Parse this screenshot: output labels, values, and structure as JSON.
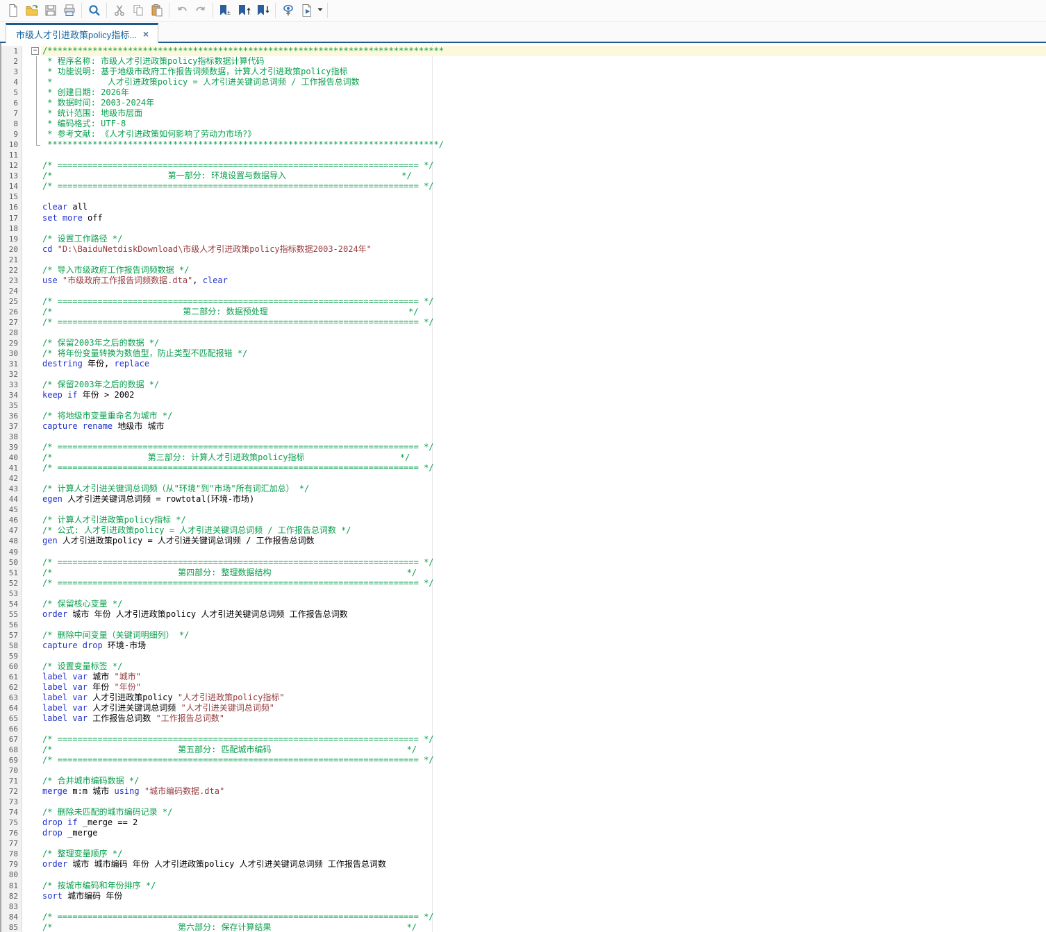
{
  "colors": {
    "accent": "#1C5A8E",
    "tab_title": "#1464A0",
    "current_line_bg": "#FCF8DC",
    "comment": "#089E4C",
    "keyword": "#2233CC",
    "string": "#973B3E",
    "plain": "#000000",
    "line_number": "#5C5C5C"
  },
  "toolbar": {
    "buttons": [
      "new-file",
      "open-file",
      "save-file",
      "print",
      "find",
      "cut",
      "copy",
      "paste",
      "undo",
      "redo",
      "bookmark-toggle",
      "bookmark-previous",
      "bookmark-next",
      "preview",
      "execute-do",
      "execute-menu"
    ]
  },
  "tab": {
    "title": "市级人才引进政策policy指标...",
    "close_glyph": "×"
  },
  "editor": {
    "current_line": 1,
    "total_lines": 85,
    "lines": [
      [
        {
          "t": "/*******************************************************************************",
          "c": "c"
        }
      ],
      [
        {
          "t": " * 程序名称: 市级人才引进政策policy指标数据计算代码",
          "c": "c"
        }
      ],
      [
        {
          "t": " * 功能说明: 基于地级市政府工作报告词频数据，计算人才引进政策policy指标",
          "c": "c"
        }
      ],
      [
        {
          "t": " *           人才引进政策policy = 人才引进关键词总词频 / 工作报告总词数",
          "c": "c"
        }
      ],
      [
        {
          "t": " * 创建日期: 2026年",
          "c": "c"
        }
      ],
      [
        {
          "t": " * 数据时间: 2003-2024年",
          "c": "c"
        }
      ],
      [
        {
          "t": " * 统计范围: 地级市层面",
          "c": "c"
        }
      ],
      [
        {
          "t": " * 编码格式: UTF-8",
          "c": "c"
        }
      ],
      [
        {
          "t": " * 参考文献: 《人才引进政策如何影响了劳动力市场?》",
          "c": "c"
        }
      ],
      [
        {
          "t": " ******************************************************************************/",
          "c": "c"
        }
      ],
      [],
      [
        {
          "t": "/* ======================================================================== */",
          "c": "c"
        }
      ],
      [
        {
          "t": "/*                       第一部分: 环境设置与数据导入                       */",
          "c": "c"
        }
      ],
      [
        {
          "t": "/* ======================================================================== */",
          "c": "c"
        }
      ],
      [],
      [
        {
          "t": "clear",
          "c": "k"
        },
        {
          "t": " all",
          "c": "t"
        }
      ],
      [
        {
          "t": "set more",
          "c": "k"
        },
        {
          "t": " off",
          "c": "t"
        }
      ],
      [],
      [
        {
          "t": "/* 设置工作路径 */",
          "c": "c"
        }
      ],
      [
        {
          "t": "cd",
          "c": "k"
        },
        {
          "t": " ",
          "c": "t"
        },
        {
          "t": "\"D:\\BaiduNetdiskDownload\\市级人才引进政策policy指标数据2003-2024年\"",
          "c": "s"
        }
      ],
      [],
      [
        {
          "t": "/* 导入市级政府工作报告词频数据 */",
          "c": "c"
        }
      ],
      [
        {
          "t": "use",
          "c": "k"
        },
        {
          "t": " ",
          "c": "t"
        },
        {
          "t": "\"市级政府工作报告词频数据.dta\"",
          "c": "s"
        },
        {
          "t": ", ",
          "c": "t"
        },
        {
          "t": "clear",
          "c": "k"
        }
      ],
      [],
      [
        {
          "t": "/* ======================================================================== */",
          "c": "c"
        }
      ],
      [
        {
          "t": "/*                          第二部分: 数据预处理                            */",
          "c": "c"
        }
      ],
      [
        {
          "t": "/* ======================================================================== */",
          "c": "c"
        }
      ],
      [],
      [
        {
          "t": "/* 保留2003年之后的数据 */",
          "c": "c"
        }
      ],
      [
        {
          "t": "/* 将年份变量转换为数值型，防止类型不匹配报错 */",
          "c": "c"
        }
      ],
      [
        {
          "t": "destring",
          "c": "k"
        },
        {
          "t": " 年份, ",
          "c": "t"
        },
        {
          "t": "replace",
          "c": "k"
        }
      ],
      [],
      [
        {
          "t": "/* 保留2003年之后的数据 */",
          "c": "c"
        }
      ],
      [
        {
          "t": "keep if",
          "c": "k"
        },
        {
          "t": " 年份 > 2002",
          "c": "t"
        }
      ],
      [],
      [
        {
          "t": "/* 将地级市变量重命名为城市 */",
          "c": "c"
        }
      ],
      [
        {
          "t": "capture rename",
          "c": "k"
        },
        {
          "t": " 地级市 城市",
          "c": "t"
        }
      ],
      [],
      [
        {
          "t": "/* ======================================================================== */",
          "c": "c"
        }
      ],
      [
        {
          "t": "/*                   第三部分: 计算人才引进政策policy指标                   */",
          "c": "c"
        }
      ],
      [
        {
          "t": "/* ======================================================================== */",
          "c": "c"
        }
      ],
      [],
      [
        {
          "t": "/* 计算人才引进关键词总词频（从\"环境\"到\"市场\"所有词汇加总） */",
          "c": "c"
        }
      ],
      [
        {
          "t": "egen",
          "c": "k"
        },
        {
          "t": " 人才引进关键词总词频 = rowtotal(环境-市场)",
          "c": "t"
        }
      ],
      [],
      [
        {
          "t": "/* 计算人才引进政策policy指标 */",
          "c": "c"
        }
      ],
      [
        {
          "t": "/* 公式: 人才引进政策policy = 人才引进关键词总词频 / 工作报告总词数 */",
          "c": "c"
        }
      ],
      [
        {
          "t": "gen",
          "c": "k"
        },
        {
          "t": " 人才引进政策policy = 人才引进关键词总词频 / 工作报告总词数",
          "c": "t"
        }
      ],
      [],
      [
        {
          "t": "/* ======================================================================== */",
          "c": "c"
        }
      ],
      [
        {
          "t": "/*                         第四部分: 整理数据结构                           */",
          "c": "c"
        }
      ],
      [
        {
          "t": "/* ======================================================================== */",
          "c": "c"
        }
      ],
      [],
      [
        {
          "t": "/* 保留核心变量 */",
          "c": "c"
        }
      ],
      [
        {
          "t": "order",
          "c": "k"
        },
        {
          "t": " 城市 年份 人才引进政策policy 人才引进关键词总词频 工作报告总词数",
          "c": "t"
        }
      ],
      [],
      [
        {
          "t": "/* 删除中间变量（关键词明细列） */",
          "c": "c"
        }
      ],
      [
        {
          "t": "capture drop",
          "c": "k"
        },
        {
          "t": " 环境-市场",
          "c": "t"
        }
      ],
      [],
      [
        {
          "t": "/* 设置变量标签 */",
          "c": "c"
        }
      ],
      [
        {
          "t": "label var",
          "c": "k"
        },
        {
          "t": " 城市 ",
          "c": "t"
        },
        {
          "t": "\"城市\"",
          "c": "s"
        }
      ],
      [
        {
          "t": "label var",
          "c": "k"
        },
        {
          "t": " 年份 ",
          "c": "t"
        },
        {
          "t": "\"年份\"",
          "c": "s"
        }
      ],
      [
        {
          "t": "label var",
          "c": "k"
        },
        {
          "t": " 人才引进政策policy ",
          "c": "t"
        },
        {
          "t": "\"人才引进政策policy指标\"",
          "c": "s"
        }
      ],
      [
        {
          "t": "label var",
          "c": "k"
        },
        {
          "t": " 人才引进关键词总词频 ",
          "c": "t"
        },
        {
          "t": "\"人才引进关键词总词频\"",
          "c": "s"
        }
      ],
      [
        {
          "t": "label var",
          "c": "k"
        },
        {
          "t": " 工作报告总词数 ",
          "c": "t"
        },
        {
          "t": "\"工作报告总词数\"",
          "c": "s"
        }
      ],
      [],
      [
        {
          "t": "/* ======================================================================== */",
          "c": "c"
        }
      ],
      [
        {
          "t": "/*                         第五部分: 匹配城市编码                           */",
          "c": "c"
        }
      ],
      [
        {
          "t": "/* ======================================================================== */",
          "c": "c"
        }
      ],
      [],
      [
        {
          "t": "/* 合并城市编码数据 */",
          "c": "c"
        }
      ],
      [
        {
          "t": "merge",
          "c": "k"
        },
        {
          "t": " m:m 城市 ",
          "c": "t"
        },
        {
          "t": "using",
          "c": "k"
        },
        {
          "t": " ",
          "c": "t"
        },
        {
          "t": "\"城市编码数据.dta\"",
          "c": "s"
        }
      ],
      [],
      [
        {
          "t": "/* 删除未匹配的城市编码记录 */",
          "c": "c"
        }
      ],
      [
        {
          "t": "drop if",
          "c": "k"
        },
        {
          "t": " _merge == 2",
          "c": "t"
        }
      ],
      [
        {
          "t": "drop",
          "c": "k"
        },
        {
          "t": " _merge",
          "c": "t"
        }
      ],
      [],
      [
        {
          "t": "/* 整理变量顺序 */",
          "c": "c"
        }
      ],
      [
        {
          "t": "order",
          "c": "k"
        },
        {
          "t": " 城市 城市编码 年份 人才引进政策policy 人才引进关键词总词频 工作报告总词数",
          "c": "t"
        }
      ],
      [],
      [
        {
          "t": "/* 按城市编码和年份排序 */",
          "c": "c"
        }
      ],
      [
        {
          "t": "sort",
          "c": "k"
        },
        {
          "t": " 城市编码 年份",
          "c": "t"
        }
      ],
      [],
      [
        {
          "t": "/* ======================================================================== */",
          "c": "c"
        }
      ],
      [
        {
          "t": "/*                         第六部分: 保存计算结果                           */",
          "c": "c"
        }
      ]
    ]
  }
}
